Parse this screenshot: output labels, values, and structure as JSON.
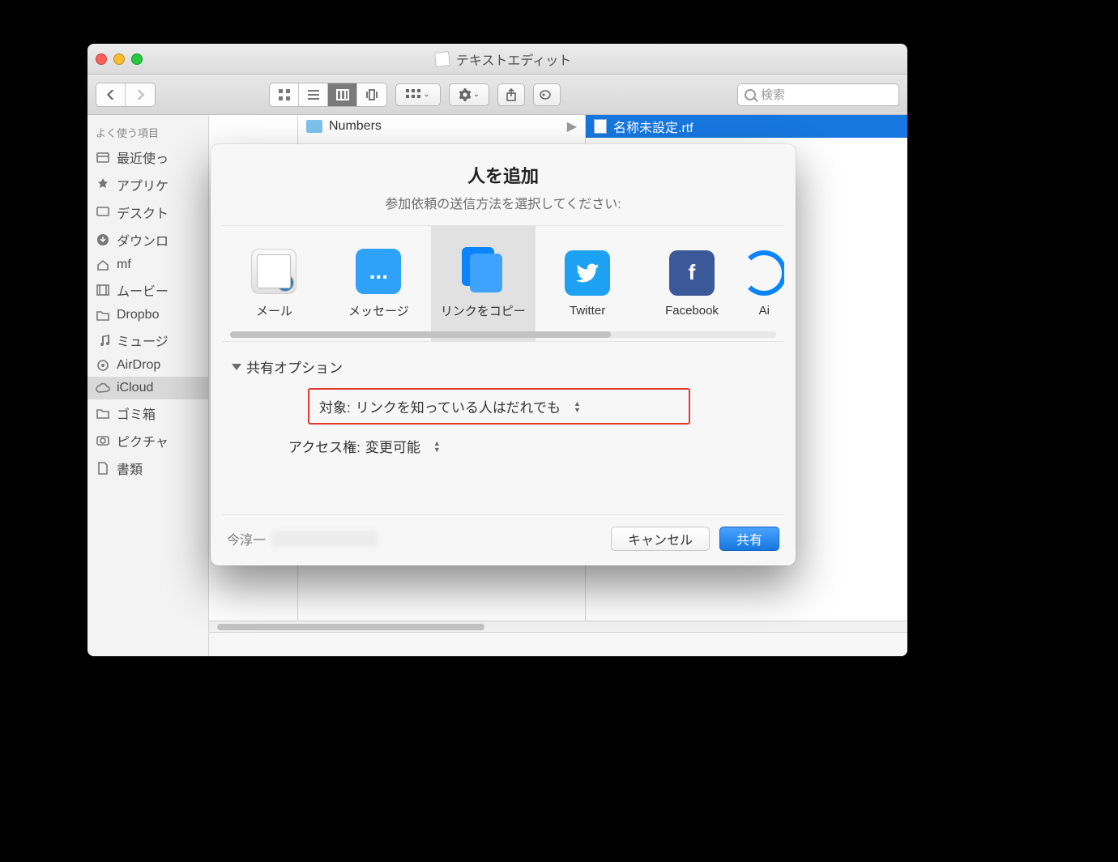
{
  "window": {
    "title": "テキストエディット",
    "search_placeholder": "検索"
  },
  "sidebar": {
    "heading": "よく使う項目",
    "items": [
      "最近使っ",
      "アプリケ",
      "デスクト",
      "ダウンロ",
      "mf",
      "ムービー",
      "Dropbo",
      "ミュージ",
      "AirDrop",
      "iCloud ",
      "ゴミ箱",
      "ピクチャ",
      "書類"
    ],
    "selected_index": 9
  },
  "columns": {
    "col1_item": "Numbers",
    "col2_item": "名称未設定.rtf"
  },
  "sheet": {
    "title": "人を追加",
    "subtitle": "参加依頼の送信方法を選択してください:",
    "apps": [
      {
        "id": "mail",
        "label": "メール"
      },
      {
        "id": "messages",
        "label": "メッセージ"
      },
      {
        "id": "copylink",
        "label": "リンクをコピー"
      },
      {
        "id": "twitter",
        "label": "Twitter"
      },
      {
        "id": "facebook",
        "label": "Facebook"
      },
      {
        "id": "airdrop",
        "label": "Ai"
      }
    ],
    "selected_app_index": 2,
    "options_heading": "共有オプション",
    "target_label": "対象:",
    "target_value": "リンクを知っている人はだれでも",
    "access_label": "アクセス権:",
    "access_value": "変更可能",
    "footer_name": "今淳一",
    "cancel": "キャンセル",
    "share": "共有"
  }
}
